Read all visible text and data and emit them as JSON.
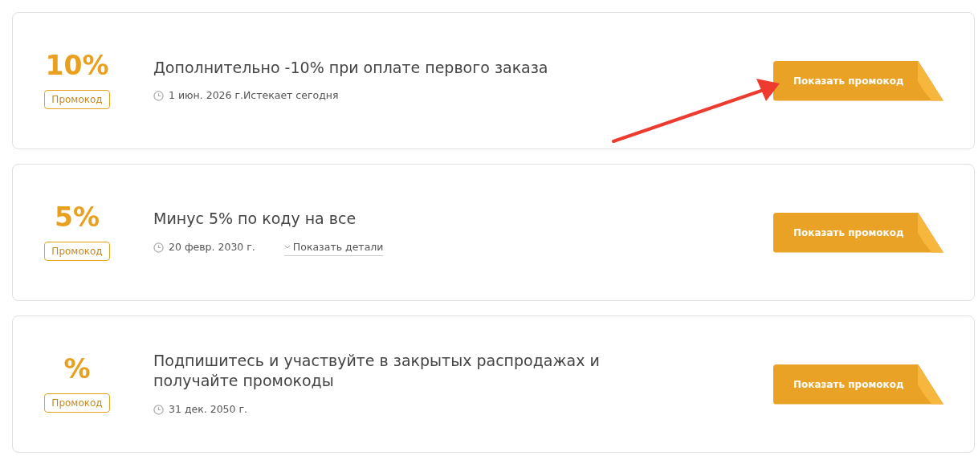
{
  "offers": [
    {
      "discount": "10%",
      "tag": "Промокод",
      "title": "Дополнительно -10% при оплате первого заказа",
      "date": "1 июн. 2026 г.",
      "note": "Истекает сегодня",
      "button": "Показать промокод",
      "annotated": true
    },
    {
      "discount": "5%",
      "tag": "Промокод",
      "title": "Минус 5% по коду на все",
      "date": "20 февр. 2030 г.",
      "details_link": "Показать детали",
      "button": "Показать промокод",
      "annotated": false
    },
    {
      "discount": "%",
      "tag": "Промокод",
      "title": "Подпишитесь и участвуйте в закрытых распродажах и получайте промокоды",
      "date": "31 дек. 2050 г.",
      "button": "Показать промокод",
      "annotated": false
    }
  ]
}
